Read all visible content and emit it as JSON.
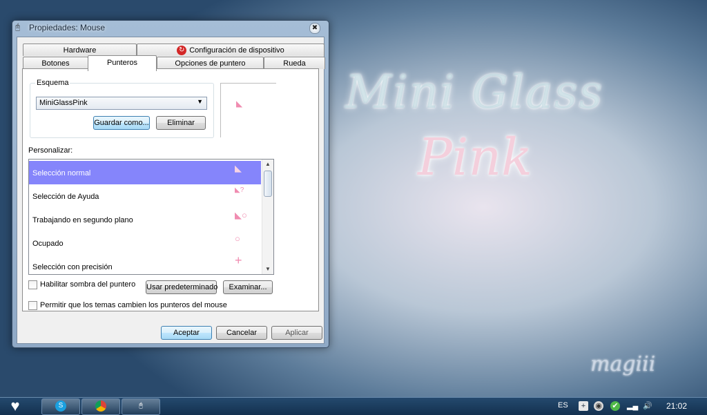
{
  "wallpaper": {
    "title": "Mini Glass",
    "subtitle": "Pink",
    "signature": "magiii"
  },
  "window": {
    "title": "Propiedades: Mouse",
    "icon": "mouse-icon"
  },
  "tabs": {
    "row1": [
      "Hardware",
      "Configuración de dispositivo"
    ],
    "row2": [
      "Botones",
      "Punteros",
      "Opciones de puntero",
      "Rueda"
    ],
    "active": "Punteros"
  },
  "scheme": {
    "label": "Esquema",
    "selected": "MiniGlassPink",
    "save_as": "Guardar como...",
    "delete": "Eliminar"
  },
  "customize": {
    "label": "Personalizar:",
    "items": [
      {
        "label": "Selección normal",
        "cursor": "🖰"
      },
      {
        "label": "Selección de Ayuda",
        "cursor": "?"
      },
      {
        "label": "Trabajando en segundo plano",
        "cursor": "◦"
      },
      {
        "label": "Ocupado",
        "cursor": "○"
      },
      {
        "label": "Selección con precisión",
        "cursor": "+"
      }
    ],
    "selected_index": 0
  },
  "options": {
    "shadow_label": "Habilitar sombra del puntero",
    "shadow_checked": false,
    "themes_label": "Permitir que los temas cambien los punteros del mouse",
    "themes_checked": false,
    "use_default": "Usar predeterminado",
    "browse": "Examinar..."
  },
  "footer": {
    "ok": "Aceptar",
    "cancel": "Cancelar",
    "apply": "Aplicar"
  },
  "taskbar": {
    "apps": [
      "skype-icon",
      "chrome-icon",
      "mouse-icon"
    ],
    "language": "ES",
    "time": "21:02"
  },
  "colors": {
    "selection": "#8585fb",
    "cursor_pink": "#f08cb0",
    "taskbar": "#1b3c5e"
  }
}
